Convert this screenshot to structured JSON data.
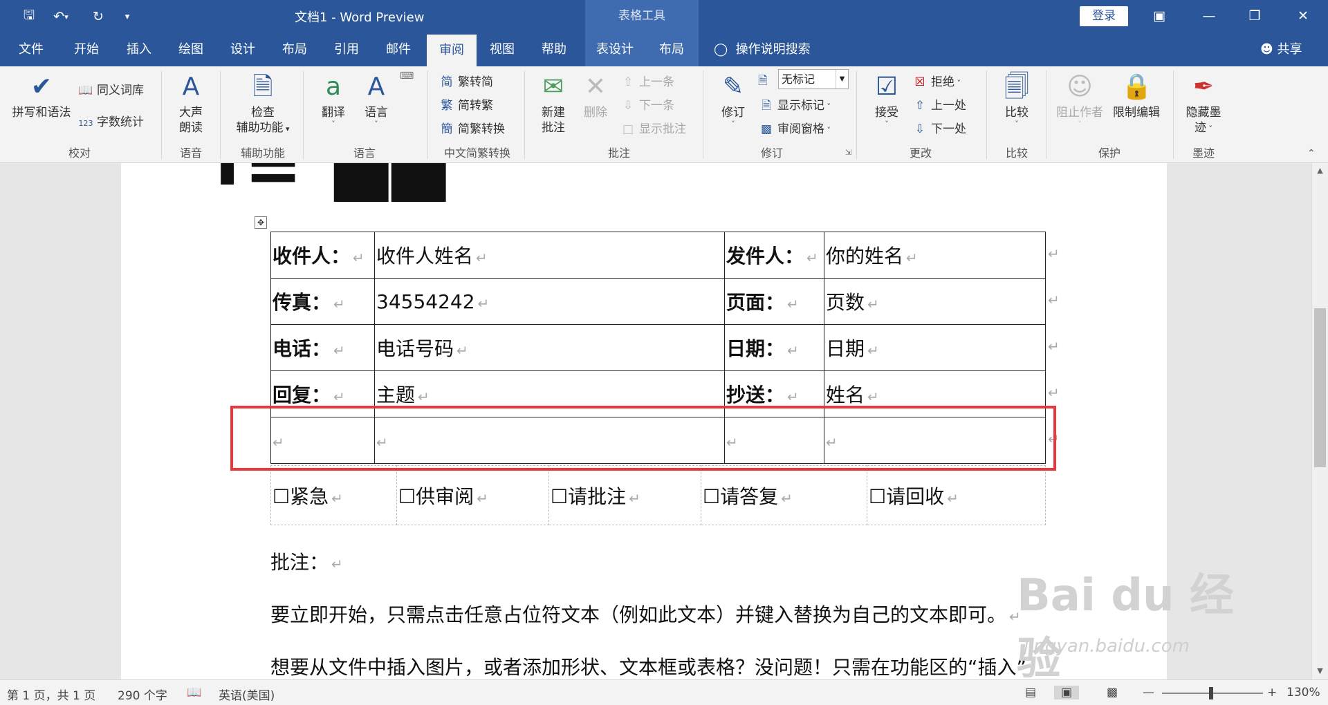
{
  "titlebar": {
    "save_icon": "save-icon",
    "undo_icon": "undo-icon",
    "redo_icon": "redo-icon",
    "title": "文档1  -  Word Preview",
    "contextual": "表格工具",
    "login": "登录",
    "ribbon_display": "ribbon-display-icon",
    "minimize": "minimize-icon",
    "restore": "restore-icon",
    "close": "close-icon"
  },
  "tabs": [
    "文件",
    "开始",
    "插入",
    "绘图",
    "设计",
    "布局",
    "引用",
    "邮件",
    "审阅",
    "视图",
    "帮助",
    "表设计",
    "布局"
  ],
  "active_tab": "审阅",
  "search_label": "操作说明搜索",
  "share_label": "共享",
  "ribbon": {
    "spelling": "拼写和语法",
    "thesaurus": "同义词库",
    "wordcount": "字数统计",
    "group_proofing": "校对",
    "read_aloud": "大声朗读",
    "group_speech": "语音",
    "check_access_1": "检查",
    "check_access_2": "辅助功能",
    "group_access": "辅助功能",
    "translate": "翻译",
    "language": "语言",
    "group_language": "语言",
    "trad_to_simp": "繁转简",
    "simp_to_trad": "简转繁",
    "simp_trad_convert": "简繁转换",
    "group_chinese": "中文简繁转换",
    "new_comment_1": "新建",
    "new_comment_2": "批注",
    "delete": "删除",
    "prev": "上一条",
    "next": "下一条",
    "show_comments": "显示批注",
    "group_comments": "批注",
    "track_changes": "修订",
    "markup_combo": "无标记",
    "show_markup": "显示标记",
    "reviewing_pane": "审阅窗格",
    "group_tracking": "修订",
    "accept": "接受",
    "reject": "拒绝",
    "prev_change": "上一处",
    "next_change": "下一处",
    "group_changes": "更改",
    "compare": "比较",
    "group_compare": "比较",
    "block_authors": "阻止作者",
    "restrict_editing": "限制编辑",
    "group_protect": "保护",
    "hide_ink_1": "隐藏墨",
    "hide_ink_2": "迹",
    "group_ink": "墨迹"
  },
  "document": {
    "fax_rows": [
      [
        "收件人：",
        "收件人姓名",
        "发件人：",
        "你的姓名"
      ],
      [
        "传真：",
        "34554242",
        "页面：",
        "页数"
      ],
      [
        "电话：",
        "电话号码",
        "日期：",
        "日期"
      ],
      [
        "回复：",
        "主题",
        "抄送：",
        "姓名"
      ],
      [
        "",
        "",
        "",
        ""
      ]
    ],
    "checkbox_items": [
      "☐紧急",
      "☐供审阅",
      "☐请批注",
      "☐请答复",
      "☐请回收"
    ],
    "para_mark": "↵",
    "comments_label": "批注：",
    "para1": "要立即开始，只需点击任意占位符文本（例如此文本）并键入替换为自己的文本即可。",
    "para2": "想要从文件中插入图片，或者添加形状、文本框或表格？没问题！只需在功能区的“插入”"
  },
  "statusbar": {
    "page": "第 1 页，共 1 页",
    "words": "290 个字",
    "language": "英语(美国)",
    "zoom": "130%"
  },
  "watermark": {
    "brand": "Bai du 经验",
    "url": "jingyan.baidu.com"
  }
}
